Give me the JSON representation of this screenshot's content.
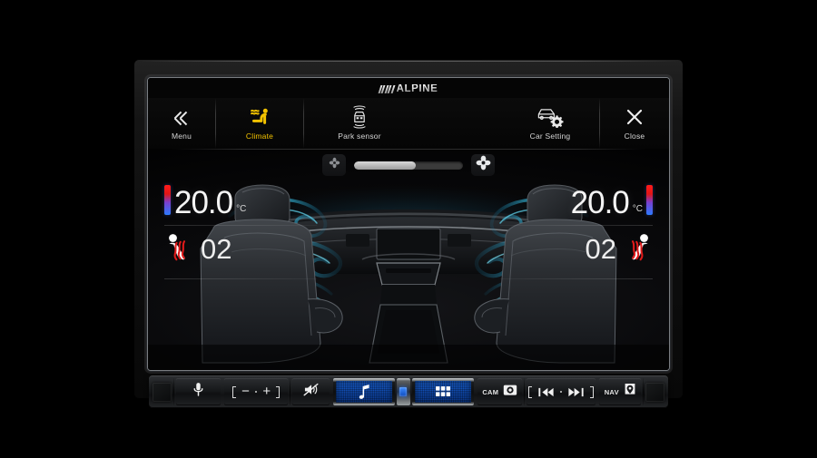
{
  "device": {
    "brand": "ALPINE",
    "brand_icon": "alpine-slashes-logo"
  },
  "topbar": {
    "items": [
      {
        "label": "Menu",
        "icon": "double-chevron-left-icon",
        "active": false
      },
      {
        "label": "Climate",
        "icon": "climate-seat-airflow-icon",
        "active": true
      },
      {
        "label": "Park sensor",
        "icon": "park-sensor-car-waves-icon",
        "active": false
      },
      {
        "label": "Car Setting",
        "icon": "car-gear-icon",
        "active": false
      },
      {
        "label": "Close",
        "icon": "close-x-icon",
        "active": false
      }
    ],
    "active_color": "#f2c200"
  },
  "climate": {
    "fan": {
      "min_icon": "fan-small-icon",
      "max_icon": "fan-large-icon",
      "level_percent": 57
    },
    "left": {
      "temperature": "20.0",
      "unit": "°C",
      "temp_bar_icon": "temperature-gradient-bar",
      "seat_heater_icon": "seat-heater-icon",
      "seat_heater_value": "02"
    },
    "right": {
      "temperature": "20.0",
      "unit": "°C",
      "temp_bar_icon": "temperature-gradient-bar",
      "seat_heater_icon": "seat-heater-icon",
      "seat_heater_value": "02"
    },
    "cabin_graphic": "car-interior-front-seats-airflow",
    "airflow_color": "#29b4d6"
  },
  "hardbuttons": {
    "items": [
      {
        "name": "ir-sensor-left",
        "label": "",
        "icon": "sensor-window-icon"
      },
      {
        "name": "voice-command",
        "label": "",
        "icon": "microphone-icon"
      },
      {
        "name": "volume-rocker",
        "label": "",
        "icon": "volume-minus-plus-icon"
      },
      {
        "name": "mute",
        "label": "",
        "icon": "speaker-mute-icon"
      },
      {
        "name": "audio-source",
        "label": "",
        "icon": "music-note-icon"
      },
      {
        "name": "power-indicator",
        "label": "",
        "icon": "blue-led-icon"
      },
      {
        "name": "apps-menu",
        "label": "",
        "icon": "grid-apps-icon"
      },
      {
        "name": "camera",
        "label": "CAM",
        "icon": "camera-icon"
      },
      {
        "name": "track-rocker",
        "label": "",
        "icon": "prev-next-track-icon"
      },
      {
        "name": "navigation",
        "label": "NAV",
        "icon": "map-pin-icon"
      },
      {
        "name": "ir-sensor-right",
        "label": "",
        "icon": "sensor-window-icon"
      }
    ]
  }
}
